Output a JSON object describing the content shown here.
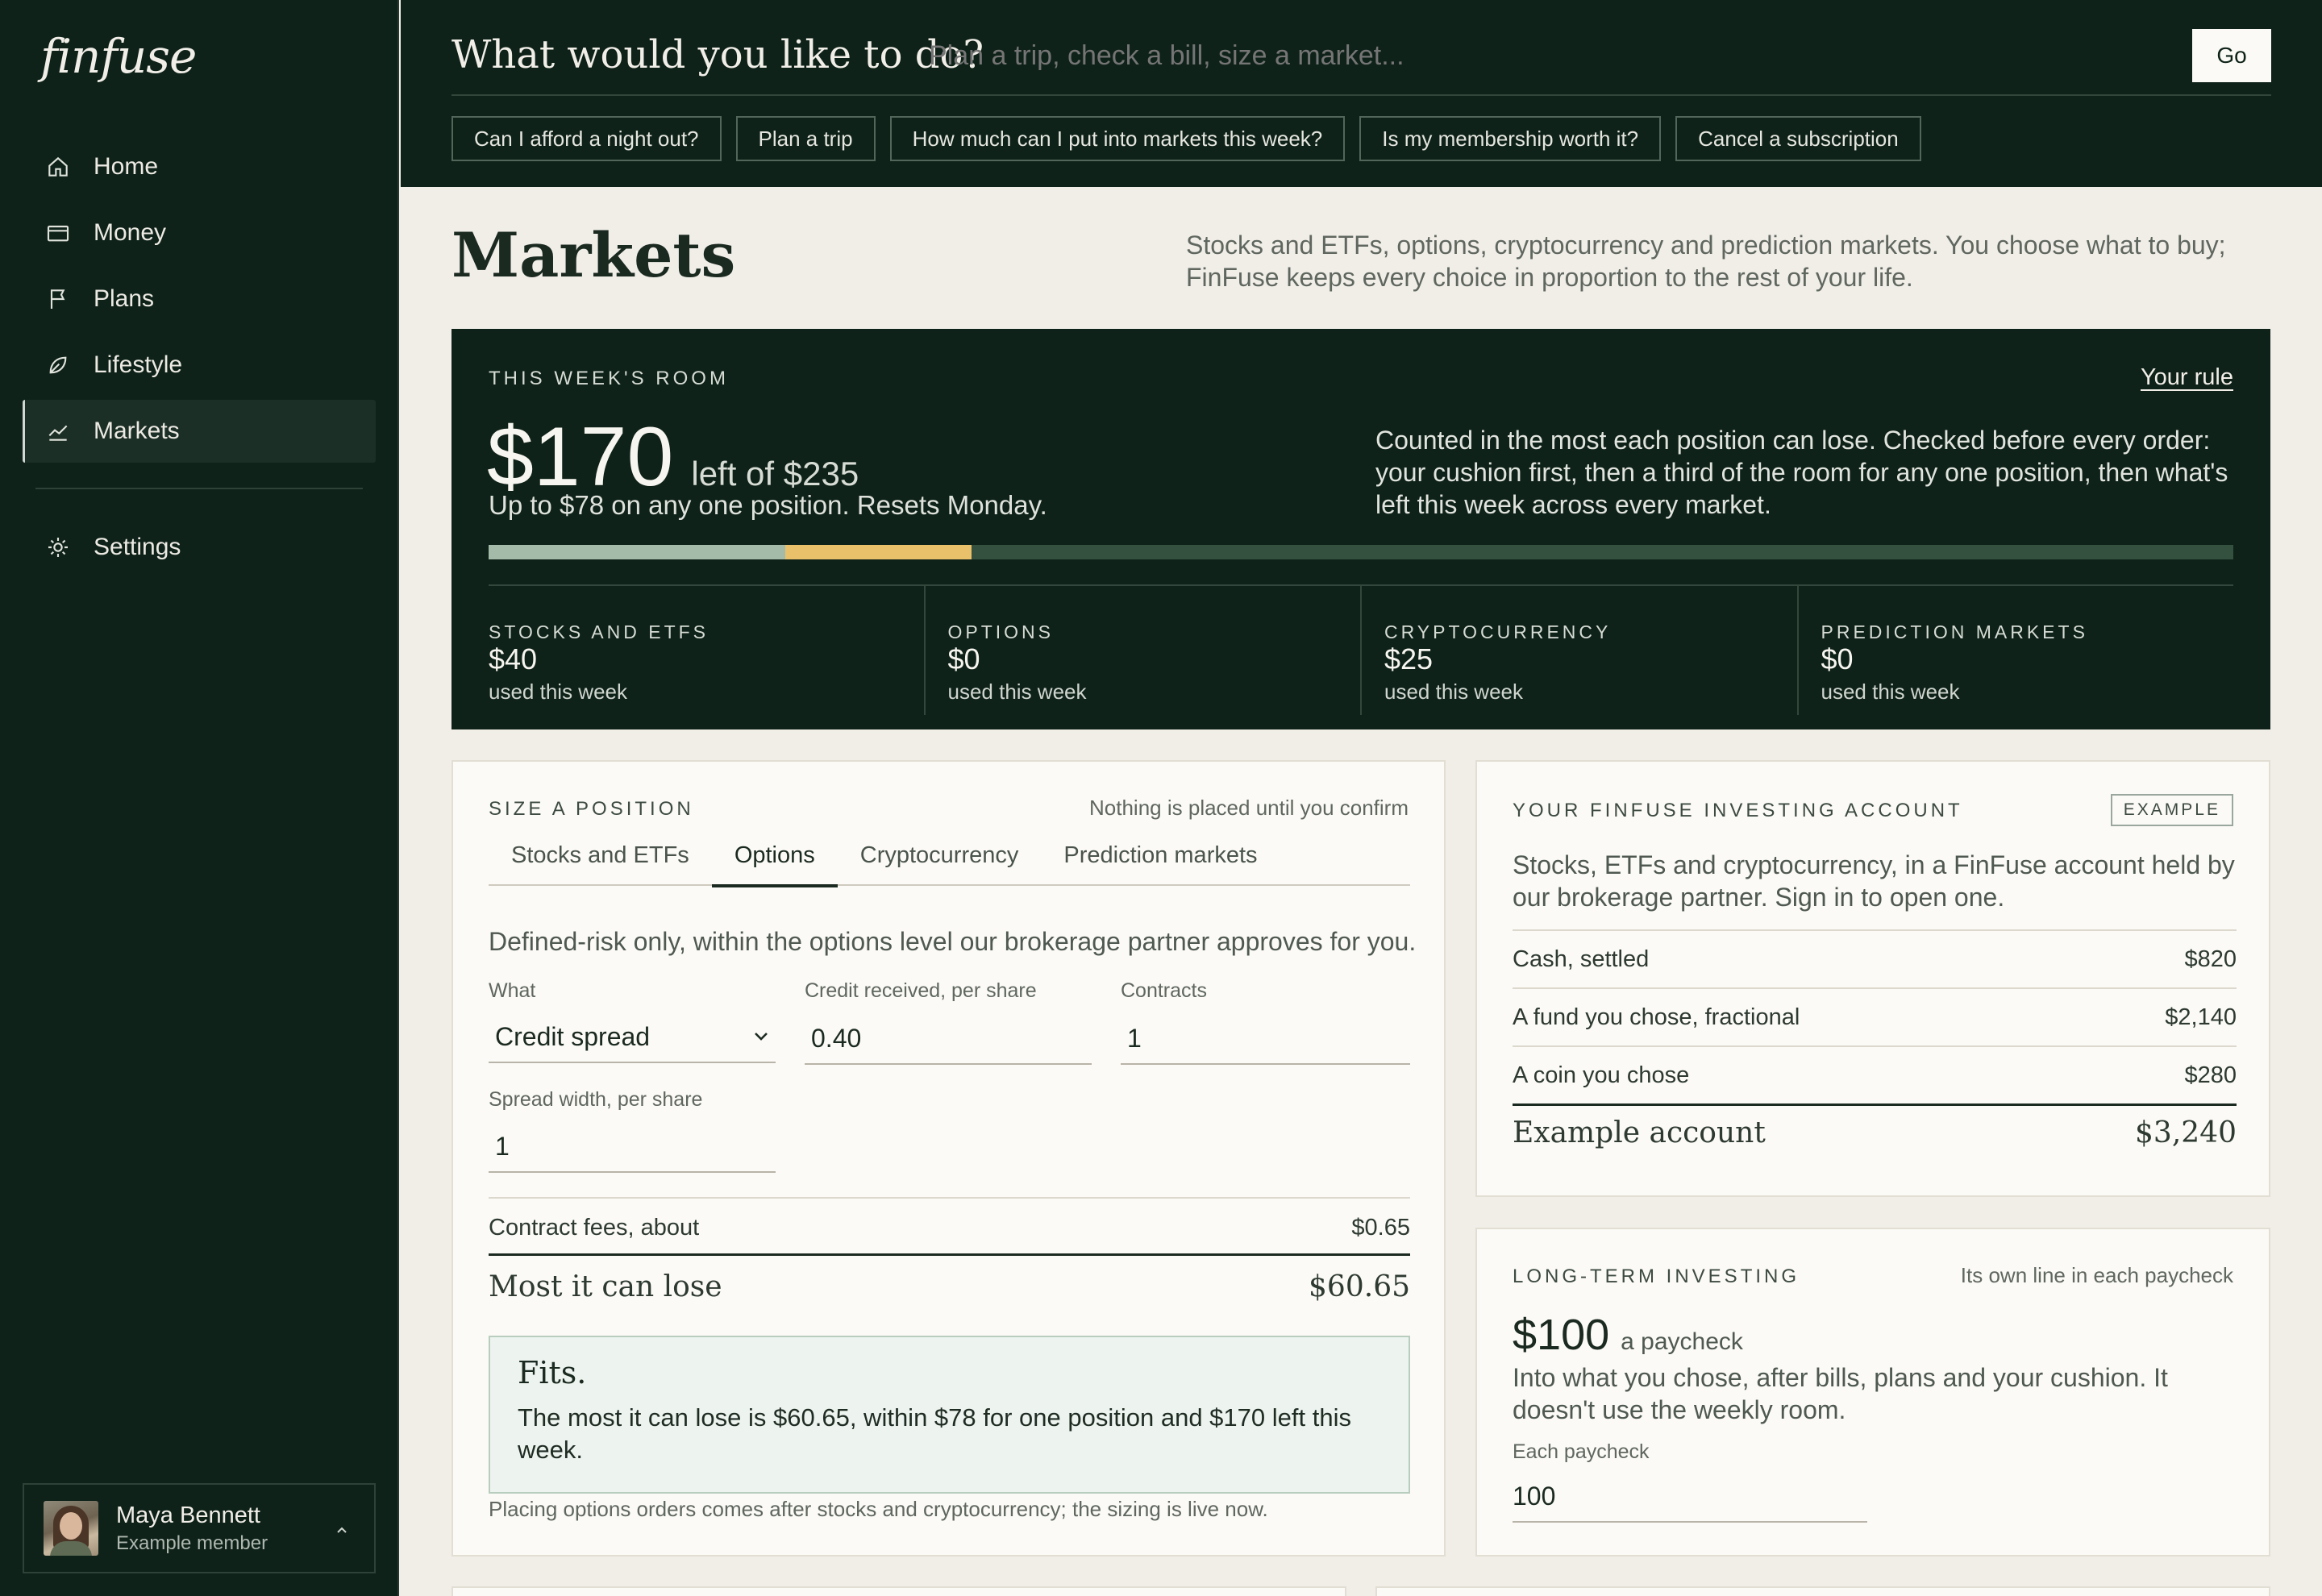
{
  "app": {
    "logo": "finfuse"
  },
  "sidebar": {
    "items": [
      {
        "label": "Home",
        "icon": "home-icon"
      },
      {
        "label": "Money",
        "icon": "wallet-icon"
      },
      {
        "label": "Plans",
        "icon": "flag-icon"
      },
      {
        "label": "Lifestyle",
        "icon": "leaf-icon"
      },
      {
        "label": "Markets",
        "icon": "chart-line-icon",
        "active": true
      }
    ],
    "settings": {
      "label": "Settings",
      "icon": "gear-icon"
    },
    "user": {
      "name": "Maya Bennett",
      "subtitle": "Example member"
    }
  },
  "topbar": {
    "prompt": "What would you like to do?",
    "input_placeholder": "Plan a trip, check a bill, size a market...",
    "go_label": "Go",
    "chips": [
      "Can I afford a night out?",
      "Plan a trip",
      "How much can I put into markets this week?",
      "Is my membership worth it?",
      "Cancel a subscription"
    ]
  },
  "page": {
    "title": "Markets",
    "description": "Stocks and ETFs, options, cryptocurrency and prediction markets. You choose what to buy; FinFuse keeps every choice in proportion to the rest of your life."
  },
  "room": {
    "eyebrow": "THIS WEEK'S ROOM",
    "rule_link": "Your rule",
    "amount_left": "$170",
    "of_total": "left of $235",
    "subline": "Up to $78 on any one position. Resets Monday.",
    "explain": "Counted in the most each position can lose. Checked before every order: your cushion first, then a third of the room for any one position, then what's left this week across every market.",
    "progress": {
      "total": 235,
      "stocks_used": 40,
      "crypto_used": 25
    },
    "colors": {
      "stocks": "#a5bba9",
      "crypto": "#e9c16a",
      "remaining": "#34503f"
    },
    "markets": [
      {
        "name": "STOCKS AND ETFS",
        "amount": "$40",
        "note": "used this week"
      },
      {
        "name": "OPTIONS",
        "amount": "$0",
        "note": "used this week"
      },
      {
        "name": "CRYPTOCURRENCY",
        "amount": "$25",
        "note": "used this week"
      },
      {
        "name": "PREDICTION MARKETS",
        "amount": "$0",
        "note": "used this week"
      }
    ]
  },
  "sizer": {
    "eyebrow": "SIZE A POSITION",
    "note": "Nothing is placed until you confirm",
    "tabs": [
      "Stocks and ETFs",
      "Options",
      "Cryptocurrency",
      "Prediction markets"
    ],
    "active_tab": "Options",
    "defined": "Defined-risk only, within the options level our brokerage partner approves for you.",
    "fields": {
      "what": {
        "label": "What",
        "value": "Credit spread"
      },
      "credit": {
        "label": "Credit received, per share",
        "value": "0.40"
      },
      "contracts": {
        "label": "Contracts",
        "value": "1"
      },
      "width": {
        "label": "Spread width, per share",
        "value": "1"
      }
    },
    "fees": {
      "label": "Contract fees, about",
      "value": "$0.65"
    },
    "most": {
      "label": "Most it can lose",
      "value": "$60.65"
    },
    "fits": {
      "title": "Fits.",
      "body": "The most it can lose is $60.65, within $78 for one position and $170 left this week."
    },
    "footnote": "Placing options orders comes after stocks and cryptocurrency; the sizing is live now."
  },
  "account": {
    "eyebrow": "YOUR FINFUSE INVESTING ACCOUNT",
    "badge": "EXAMPLE",
    "description": "Stocks, ETFs and cryptocurrency, in a FinFuse account held by our brokerage partner. Sign in to open one.",
    "rows": [
      {
        "label": "Cash, settled",
        "value": "$820"
      },
      {
        "label": "A fund you chose, fractional",
        "value": "$2,140"
      },
      {
        "label": "A coin you chose",
        "value": "$280"
      }
    ],
    "total": {
      "label": "Example account",
      "value": "$3,240"
    }
  },
  "longterm": {
    "eyebrow": "LONG-TERM INVESTING",
    "note": "Its own line in each paycheck",
    "amount": "$100",
    "per": "a paycheck",
    "description": "Into what you chose, after bills, plans and your cushion. It doesn't use the weekly room.",
    "field_label": "Each paycheck",
    "field_value": "100"
  }
}
